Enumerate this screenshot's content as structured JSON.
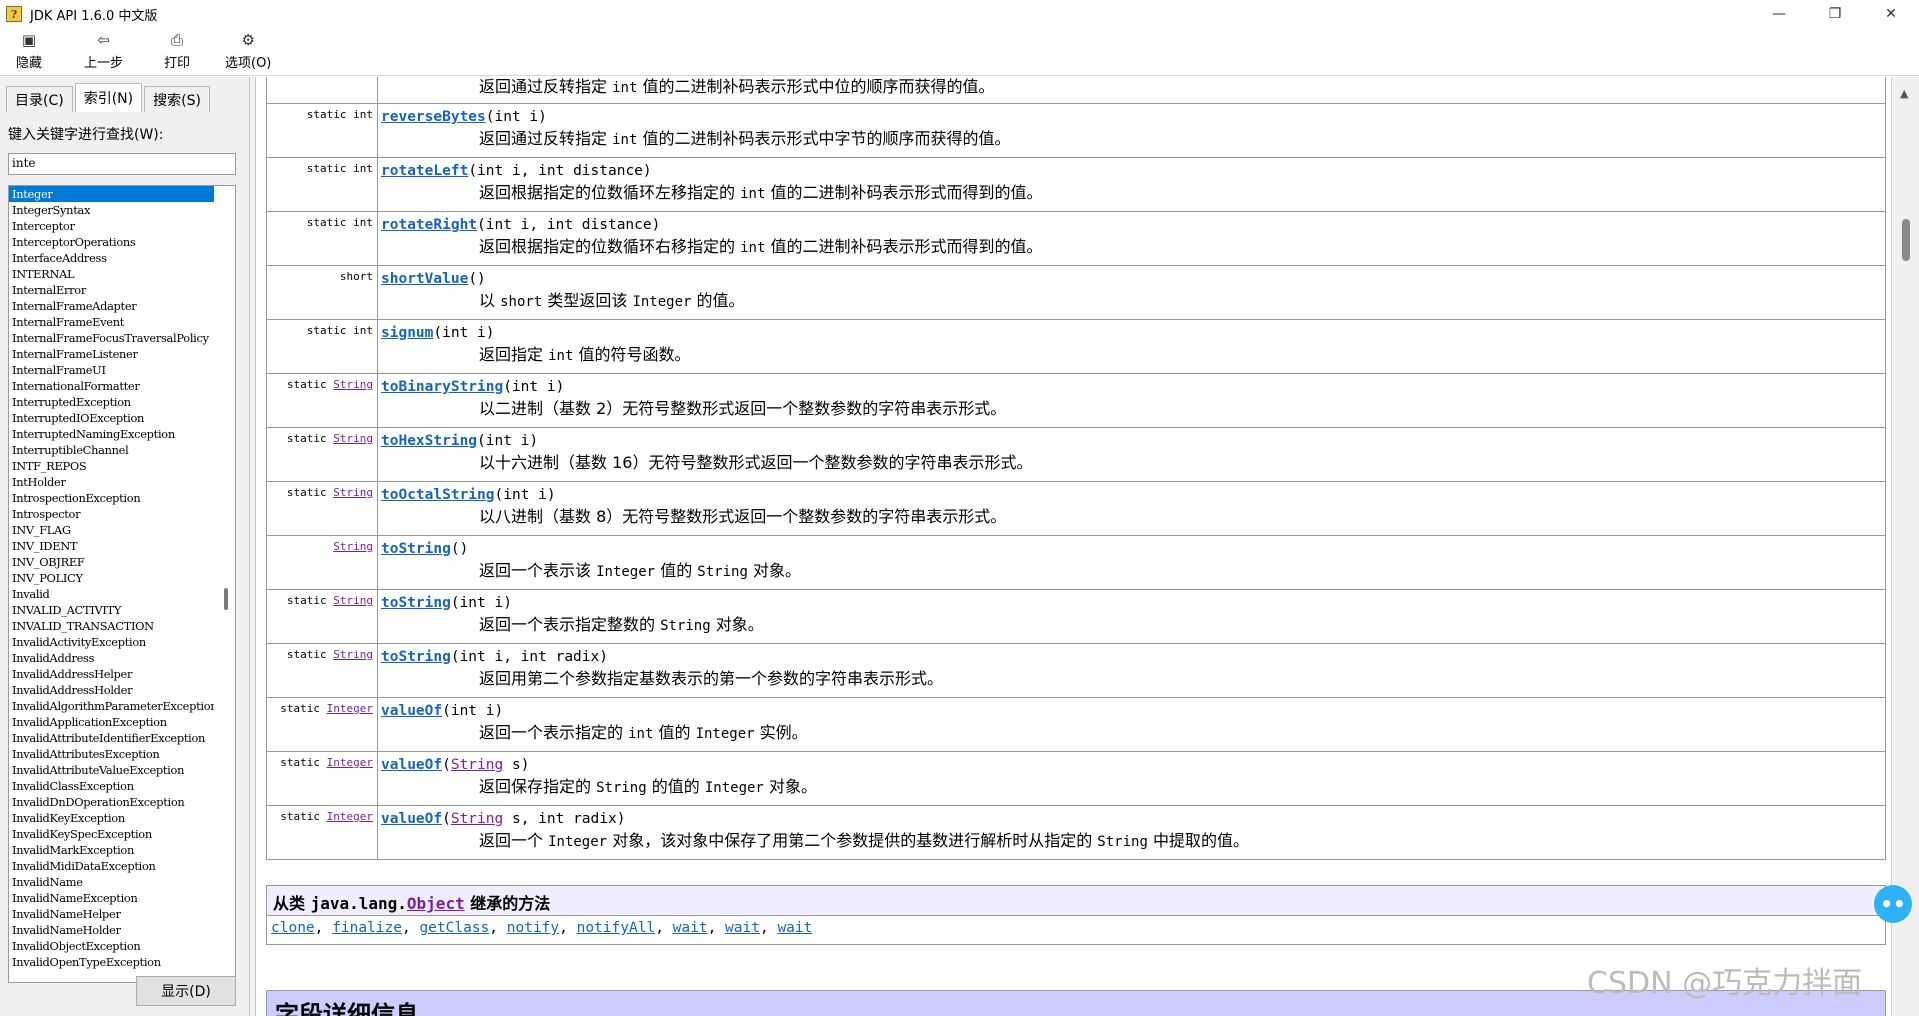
{
  "window": {
    "title": "JDK API 1.6.0 中文版",
    "minimize": "—",
    "maximize": "❐",
    "close": "✕"
  },
  "toolbar": [
    {
      "icon": "hide-icon",
      "glyph": "▣",
      "label": "隐藏"
    },
    {
      "icon": "back-arrow-icon",
      "glyph": "⇦",
      "label": "上一步"
    },
    {
      "icon": "printer-icon",
      "glyph": "⎙",
      "label": "打印"
    },
    {
      "icon": "options-icon",
      "glyph": "⚙",
      "label": "选项(O)"
    }
  ],
  "left": {
    "tabs": [
      {
        "label": "目录(C)"
      },
      {
        "label": "索引(N)"
      },
      {
        "label": "搜索(S)"
      }
    ],
    "search_label": "键入关键字进行查找(W):",
    "search_value": "inte",
    "items": [
      "Integer",
      "IntegerSyntax",
      "Interceptor",
      "InterceptorOperations",
      "InterfaceAddress",
      "INTERNAL",
      "InternalError",
      "InternalFrameAdapter",
      "InternalFrameEvent",
      "InternalFrameFocusTraversalPolicy",
      "InternalFrameListener",
      "InternalFrameUI",
      "InternationalFormatter",
      "InterruptedException",
      "InterruptedIOException",
      "InterruptedNamingException",
      "InterruptibleChannel",
      "INTF_REPOS",
      "IntHolder",
      "IntrospectionException",
      "Introspector",
      "INV_FLAG",
      "INV_IDENT",
      "INV_OBJREF",
      "INV_POLICY",
      "Invalid",
      "INVALID_ACTIVITY",
      "INVALID_TRANSACTION",
      "InvalidActivityException",
      "InvalidAddress",
      "InvalidAddressHelper",
      "InvalidAddressHolder",
      "InvalidAlgorithmParameterException",
      "InvalidApplicationException",
      "InvalidAttributeIdentifierException",
      "InvalidAttributesException",
      "InvalidAttributeValueException",
      "InvalidClassException",
      "InvalidDnDOperationException",
      "InvalidKeyException",
      "InvalidKeySpecException",
      "InvalidMarkException",
      "InvalidMidiDataException",
      "InvalidName",
      "InvalidNameException",
      "InvalidNameHelper",
      "InvalidNameHolder",
      "InvalidObjectException",
      "InvalidOpenTypeException"
    ],
    "show_button": "显示(D)"
  },
  "methods": [
    {
      "mod": "",
      "type": "",
      "name": "",
      "params": [],
      "desc": [
        {
          "t": "返回通过反转指定 "
        },
        {
          "t": "int",
          "m": true
        },
        {
          "t": " 值的二进制补码表示形式中位的顺序而获得的值。"
        }
      ]
    },
    {
      "mod": "static int",
      "type": "",
      "name": "reverseBytes",
      "params": [
        {
          "t": "(int i)"
        }
      ],
      "desc": [
        {
          "t": "返回通过反转指定 "
        },
        {
          "t": "int",
          "m": true
        },
        {
          "t": " 值的二进制补码表示形式中字节的顺序而获得的值。"
        }
      ]
    },
    {
      "mod": "static int",
      "type": "",
      "name": "rotateLeft",
      "params": [
        {
          "t": "(int i, int distance)"
        }
      ],
      "desc": [
        {
          "t": "返回根据指定的位数循环左移指定的 "
        },
        {
          "t": "int",
          "m": true
        },
        {
          "t": " 值的二进制补码表示形式而得到的值。"
        }
      ]
    },
    {
      "mod": "static int",
      "type": "",
      "name": "rotateRight",
      "params": [
        {
          "t": "(int i, int distance)"
        }
      ],
      "desc": [
        {
          "t": "返回根据指定的位数循环右移指定的 "
        },
        {
          "t": "int",
          "m": true
        },
        {
          "t": " 值的二进制补码表示形式而得到的值。"
        }
      ]
    },
    {
      "mod": "short",
      "type": "",
      "name": "shortValue",
      "params": [
        {
          "t": "()"
        }
      ],
      "desc": [
        {
          "t": "以 "
        },
        {
          "t": "short",
          "m": true
        },
        {
          "t": " 类型返回该 "
        },
        {
          "t": "Integer",
          "m": true
        },
        {
          "t": " 的值。"
        }
      ]
    },
    {
      "mod": "static int",
      "type": "",
      "name": "signum",
      "params": [
        {
          "t": "(int i)"
        }
      ],
      "desc": [
        {
          "t": "返回指定 "
        },
        {
          "t": "int",
          "m": true
        },
        {
          "t": " 值的符号函数。"
        }
      ]
    },
    {
      "mod": "static",
      "type": "String",
      "name": "toBinaryString",
      "params": [
        {
          "t": "(int i)"
        }
      ],
      "desc": [
        {
          "t": "以二进制（基数 2）无符号整数形式返回一个整数参数的字符串表示形式。"
        }
      ]
    },
    {
      "mod": "static",
      "type": "String",
      "name": "toHexString",
      "params": [
        {
          "t": "(int i)"
        }
      ],
      "desc": [
        {
          "t": "以十六进制（基数 16）无符号整数形式返回一个整数参数的字符串表示形式。"
        }
      ]
    },
    {
      "mod": "static",
      "type": "String",
      "name": "toOctalString",
      "params": [
        {
          "t": "(int i)"
        }
      ],
      "desc": [
        {
          "t": "以八进制（基数 8）无符号整数形式返回一个整数参数的字符串表示形式。"
        }
      ]
    },
    {
      "mod": "",
      "type": "String",
      "name": "toString",
      "params": [
        {
          "t": "()"
        }
      ],
      "desc": [
        {
          "t": "返回一个表示该 "
        },
        {
          "t": "Integer",
          "m": true
        },
        {
          "t": " 值的 "
        },
        {
          "t": "String",
          "m": true
        },
        {
          "t": " 对象。"
        }
      ]
    },
    {
      "mod": "static",
      "type": "String",
      "name": "toString",
      "params": [
        {
          "t": "(int i)"
        }
      ],
      "desc": [
        {
          "t": "返回一个表示指定整数的 "
        },
        {
          "t": "String",
          "m": true
        },
        {
          "t": " 对象。"
        }
      ]
    },
    {
      "mod": "static",
      "type": "String",
      "name": "toString",
      "params": [
        {
          "t": "(int i, int radix)"
        }
      ],
      "desc": [
        {
          "t": "返回用第二个参数指定基数表示的第一个参数的字符串表示形式。"
        }
      ]
    },
    {
      "mod": "static",
      "type": "Integer",
      "name": "valueOf",
      "params": [
        {
          "t": "(int i)"
        }
      ],
      "desc": [
        {
          "t": "返回一个表示指定的 "
        },
        {
          "t": "int",
          "m": true
        },
        {
          "t": " 值的 "
        },
        {
          "t": "Integer",
          "m": true
        },
        {
          "t": " 实例。"
        }
      ]
    },
    {
      "mod": "static",
      "type": "Integer",
      "name": "valueOf",
      "params": [
        {
          "t": "("
        },
        {
          "t": "String",
          "l": true
        },
        {
          "t": " s)"
        }
      ],
      "desc": [
        {
          "t": "返回保存指定的 "
        },
        {
          "t": "String",
          "m": true
        },
        {
          "t": " 的值的 "
        },
        {
          "t": "Integer",
          "m": true
        },
        {
          "t": " 对象。"
        }
      ]
    },
    {
      "mod": "static",
      "type": "Integer",
      "name": "valueOf",
      "params": [
        {
          "t": "("
        },
        {
          "t": "String",
          "l": true
        },
        {
          "t": " s, int radix)"
        }
      ],
      "desc": [
        {
          "t": "返回一个 "
        },
        {
          "t": "Integer",
          "m": true
        },
        {
          "t": " 对象，该对象中保存了用第二个参数提供的基数进行解析时从指定的 "
        },
        {
          "t": "String",
          "m": true
        },
        {
          "t": " 中提取的值。"
        }
      ]
    }
  ],
  "inherited": {
    "prefix": "从类 ",
    "package": "java.lang.",
    "class": "Object",
    "suffix": " 继承的方法",
    "links": [
      "clone",
      "finalize",
      "getClass",
      "notify",
      "notifyAll",
      "wait",
      "wait",
      "wait"
    ]
  },
  "field_detail_heading": "字段详细信息",
  "watermark": "CSDN @巧克力拌面",
  "colors": {
    "method_link": "#1565c0",
    "type_link": "#7b1fa2",
    "selection": "#0078d7",
    "inherited_header": "#eeeeff",
    "section_header": "#ccccff"
  }
}
